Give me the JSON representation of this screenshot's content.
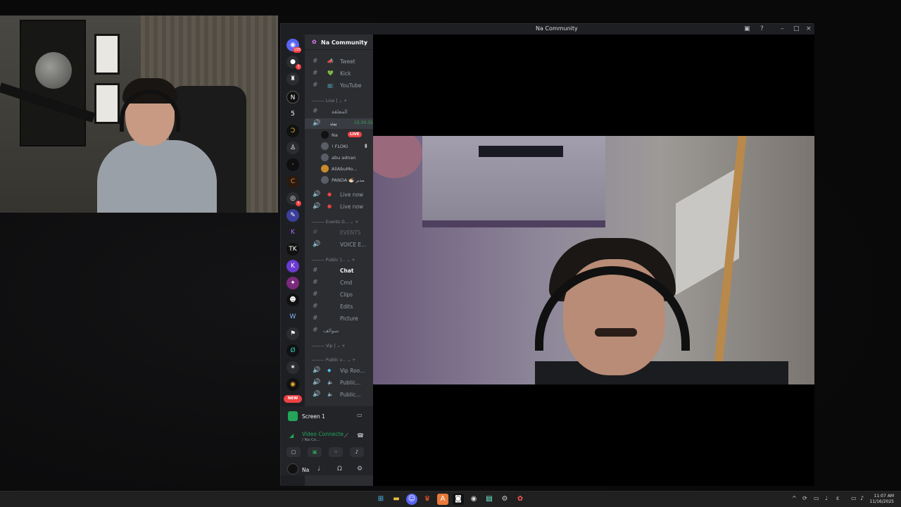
{
  "window": {
    "title": "Na Community"
  },
  "guild": {
    "name": "Na Community"
  },
  "server_badges": {
    "top": "195",
    "b1": "3",
    "b2": "5",
    "new": "NEW"
  },
  "channels": [
    {
      "type": "text",
      "emoji": "📣",
      "label": "Tweet"
    },
    {
      "type": "text",
      "emoji": "💚",
      "label": "Kick"
    },
    {
      "type": "text",
      "emoji": "📺",
      "label": "YouTube"
    }
  ],
  "cat_live": "Live ]",
  "arabic_ch": "المعلقة",
  "voice_active": {
    "name": "بث",
    "timer": "15:30:31"
  },
  "voice_users": [
    {
      "name": "Na",
      "live": "LIVE"
    },
    {
      "name": "! FLOKI"
    },
    {
      "name": "abu adnan"
    },
    {
      "name": "AliAbuMo..."
    },
    {
      "name": "PANDA 🍜 مدبر"
    }
  ],
  "live_channels": [
    "Live now",
    "Live now"
  ],
  "cat_events": "Events G...",
  "events": [
    "EVENTS",
    "VOICE E..."
  ],
  "cat_public": "Public ]...",
  "public_channels": [
    "Chat",
    "Cmd",
    "Clips",
    "Edits",
    "Picture"
  ],
  "arabic_ch2": "سوالف",
  "cat_vip": "Vip ]",
  "cat_public_v": "Public v...",
  "voice_channels": [
    "Vip Roo...",
    "Public...",
    "Public..."
  ],
  "panel": {
    "screen": "Screen 1",
    "video_status": "Video Connecte",
    "video_sub": "/ Na Co...",
    "user": "Na"
  },
  "clock": {
    "time": "11:07 AM",
    "date": "11/16/2025"
  }
}
